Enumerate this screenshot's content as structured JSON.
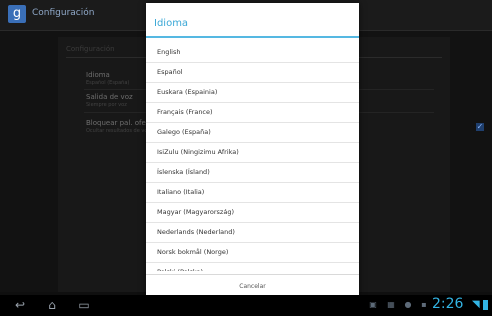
{
  "app": {
    "title": "Configuración",
    "icon": "google-search-icon"
  },
  "settings": {
    "section_header": "Configuración",
    "items": [
      {
        "title": "Idioma",
        "subtitle": "Español (España)"
      },
      {
        "title": "Salida de voz",
        "subtitle": "Siempre por voz"
      },
      {
        "title": "Bloquear pal. ofens",
        "subtitle": "Ocultar resultados de vo"
      }
    ],
    "checkbox_checked": true
  },
  "dialog": {
    "title": "Idioma",
    "languages": [
      "English",
      "Español",
      "Euskara (Espainia)",
      "Français (France)",
      "Galego (España)",
      "IsiZulu (Ningizimu Afrika)",
      "Íslenska (Ísland)",
      "Italiano (Italia)",
      "Magyar (Magyarország)",
      "Nederlands (Nederland)",
      "Norsk bokmål (Norge)",
      "Polski (Polska)"
    ],
    "cancel_label": "Cancelar"
  },
  "navbar": {
    "back": "back-icon",
    "home": "home-icon",
    "recents": "recent-apps-icon"
  },
  "status": {
    "time": "2:26",
    "accent_color": "#33b5e5"
  }
}
